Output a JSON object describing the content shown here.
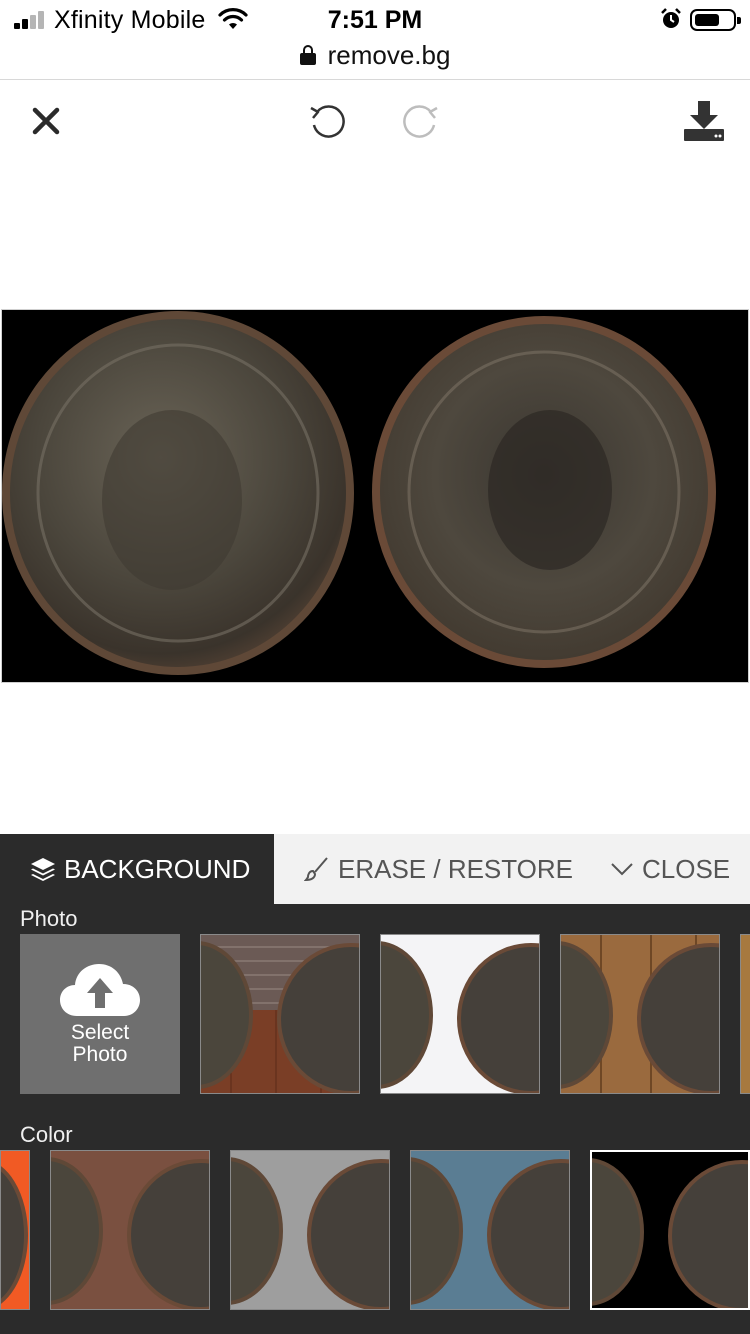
{
  "status_bar": {
    "carrier": "Xfinity Mobile",
    "time": "7:51 PM"
  },
  "browser": {
    "url": "remove.bg"
  },
  "toolbar": {
    "icons": [
      "close-icon",
      "undo-icon",
      "redo-icon",
      "download-icon"
    ]
  },
  "panel": {
    "tabs": {
      "background": "BACKGROUND",
      "erase_restore": "ERASE / RESTORE",
      "close": "CLOSE"
    },
    "photo_label": "Photo",
    "select_photo": "Select Photo",
    "color_label": "Color",
    "photo_backgrounds": [
      "brick-wall-and-wood",
      "white-gradient",
      "wood-planks",
      "partial-next"
    ],
    "color_backgrounds": [
      "#f15a24",
      "#7a5040",
      "#9e9e9e",
      "#5a7d93",
      "#000000"
    ],
    "selected_color": "#000000"
  },
  "colors": {
    "panel_bg": "#2b2b2b",
    "tab_bar_bg": "#f2f2f2",
    "upload_tile_bg": "#6f6f6f"
  }
}
